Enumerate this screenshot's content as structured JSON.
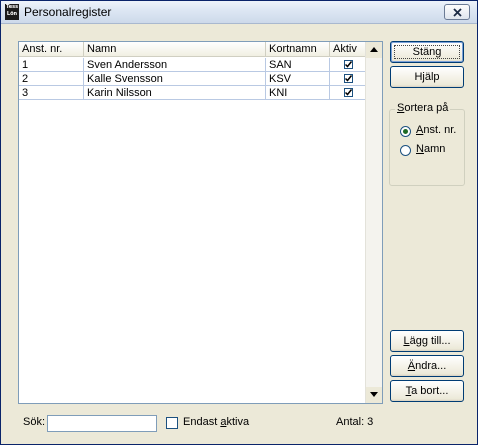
{
  "window": {
    "title": "Personalregister",
    "icon_text": [
      "Tess",
      "Lön"
    ]
  },
  "list": {
    "columns": [
      "Anst. nr.",
      "Namn",
      "Kortnamn",
      "Aktiv"
    ],
    "rows": [
      {
        "nr": "1",
        "name": "Sven Andersson",
        "short": "SAN",
        "active": true
      },
      {
        "nr": "2",
        "name": "Kalle Svensson",
        "short": "KSV",
        "active": true
      },
      {
        "nr": "3",
        "name": "Karin Nilsson",
        "short": "KNI",
        "active": true
      }
    ]
  },
  "buttons": {
    "close": "Stäng",
    "help": "Hjälp",
    "add_pre": "",
    "add_accel": "L",
    "add_post": "ägg till...",
    "edit_pre": "",
    "edit_accel": "Ä",
    "edit_post": "ndra...",
    "delete_pre": "",
    "delete_accel": "T",
    "delete_post": "a bort..."
  },
  "sort": {
    "title_pre": "",
    "title_accel": "S",
    "title_post": "ortera på",
    "opt1_pre": "",
    "opt1_accel": "A",
    "opt1_post": "nst. nr.",
    "opt2_pre": "",
    "opt2_accel": "N",
    "opt2_post": "amn",
    "selected": "Anst. nr."
  },
  "footer": {
    "search_label": "Sök:",
    "search_value": "",
    "only_active_pre": "Endast ",
    "only_active_accel": "a",
    "only_active_post": "ktiva",
    "only_active_checked": false,
    "count_text": "Antal: 3"
  },
  "colors": {
    "selection_border": "#003c74",
    "checkbox_border": "#1c5180"
  }
}
